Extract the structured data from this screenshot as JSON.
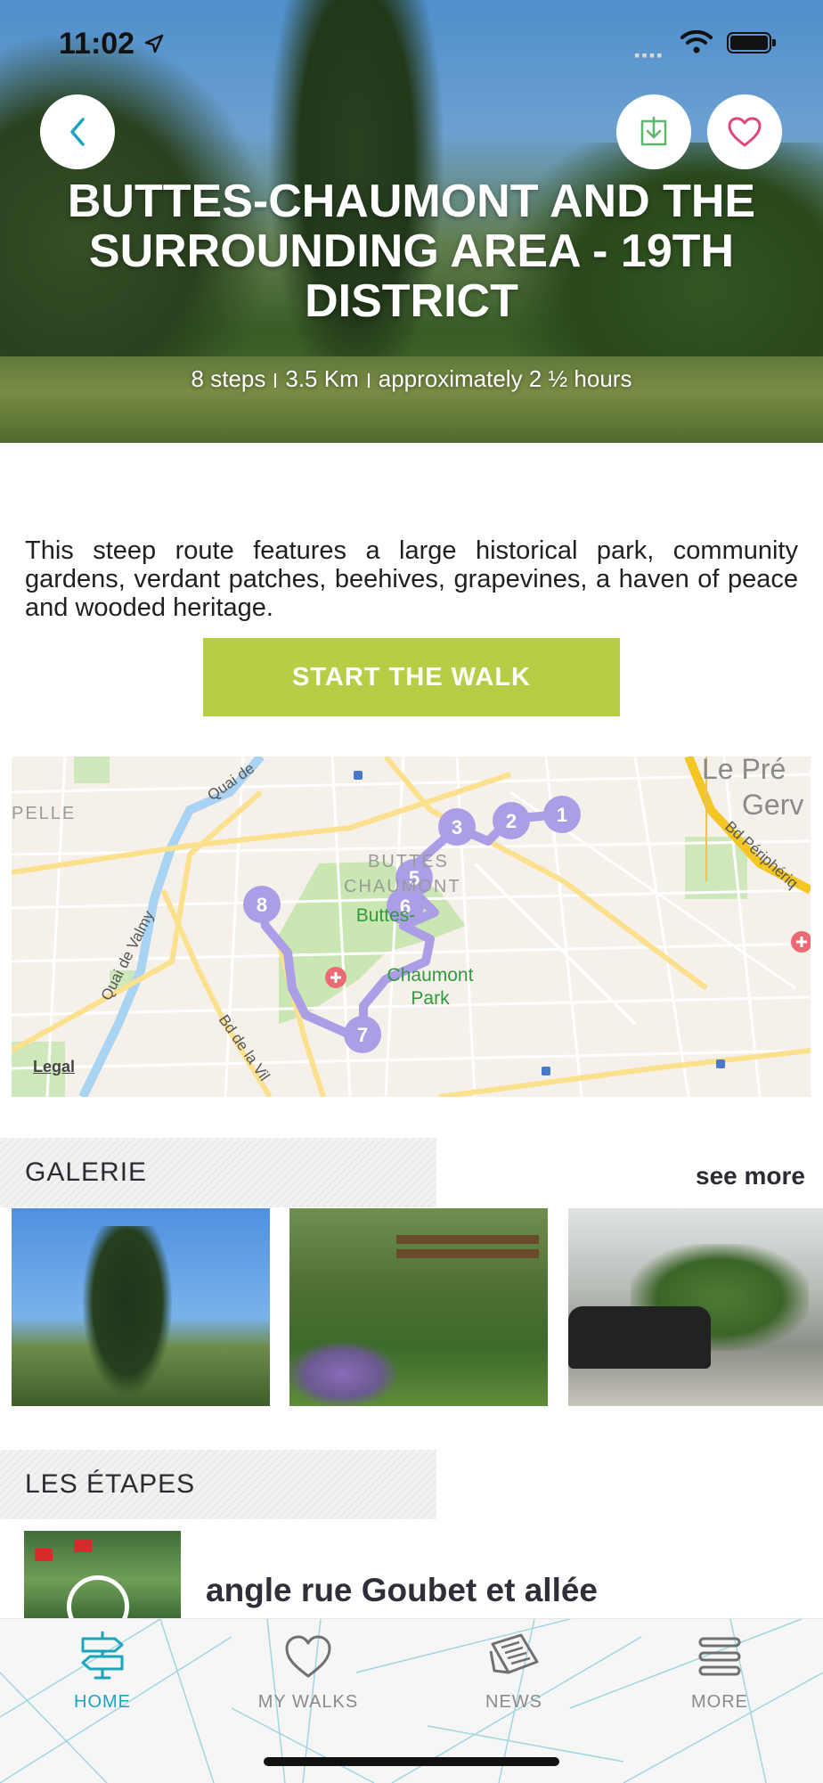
{
  "status_bar": {
    "time": "11:02"
  },
  "header": {
    "title": "BUTTES-CHAUMONT AND THE SURROUNDING AREA - 19th DISTRICT",
    "meta": {
      "steps": "8 steps",
      "distance": "3.5 Km",
      "duration": "approximately 2 ½ hours"
    }
  },
  "description": "This steep route features a large historical park, community gardens, verdant patches, beehives, grapevines, a haven of peace and wooded heritage.",
  "start_button": "START THE WALK",
  "map": {
    "labels": {
      "park": "Buttes-Chaumont Park",
      "park_line1": "Buttes-",
      "park_line2": "Chaumont",
      "park_line3": "Park",
      "district_line1": "BUTTES",
      "district_line2": "CHAUMONT",
      "quai_valmy": "Quai de Valmy",
      "quai_top": "Quai de",
      "bd_peripherique": "Bd Périphériq",
      "bd_villette": "Bd de la Vil",
      "le_pre": "Le Pré",
      "gerv": "Gerv",
      "pelle": "PELLE",
      "legal": "Legal"
    },
    "markers": [
      "1",
      "2",
      "3",
      "5",
      "6",
      "7",
      "8"
    ],
    "route_color": "#ab9ee6"
  },
  "galerie": {
    "title": "GALERIE",
    "see_more": "see more"
  },
  "etapes": {
    "title": "LES ÉTAPES",
    "first_step_title": "angle rue Goubet et allée"
  },
  "tabbar": {
    "items": [
      {
        "label": "HOME",
        "icon": "signpost-icon",
        "active": true
      },
      {
        "label": "MY WALKS",
        "icon": "heart-icon",
        "active": false
      },
      {
        "label": "NEWS",
        "icon": "newspaper-icon",
        "active": false
      },
      {
        "label": "MORE",
        "icon": "menu-icon",
        "active": false
      }
    ]
  },
  "colors": {
    "accent": "#1aa5bd",
    "start_button": "#b7cd45",
    "route": "#ab9ee6",
    "favorite": "#e0457b",
    "download": "#5bb86a"
  }
}
